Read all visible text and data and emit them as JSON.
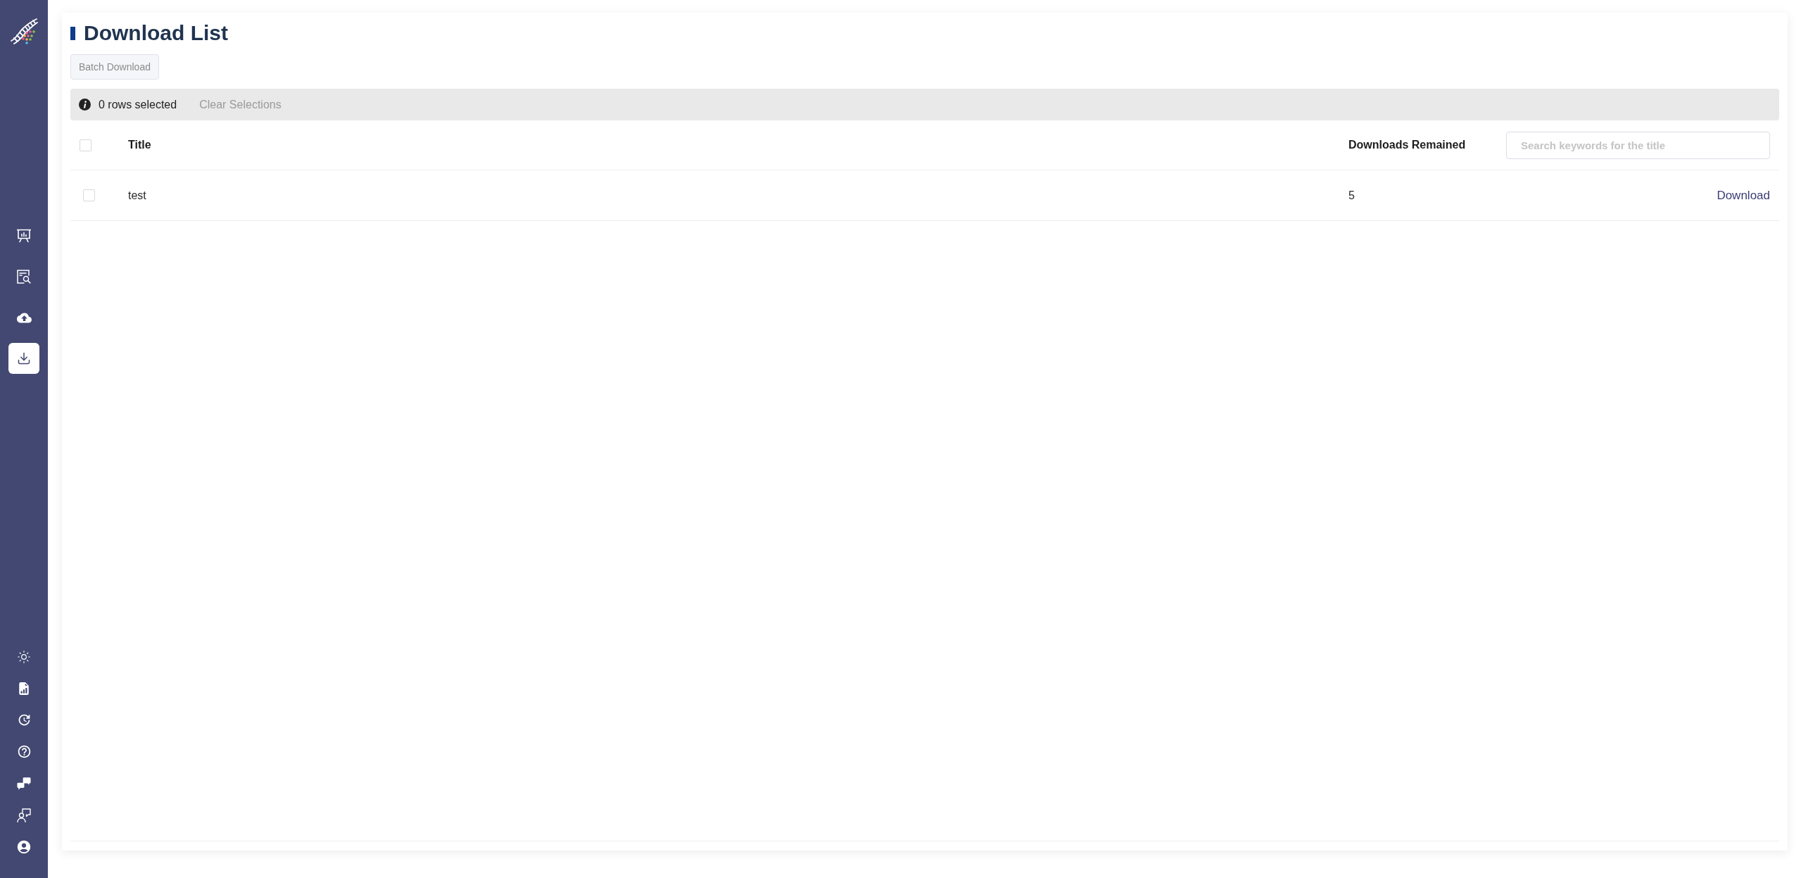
{
  "sidebar": {
    "nav_items": [
      {
        "selected": false
      },
      {
        "selected": false
      },
      {
        "selected": false
      },
      {
        "selected": true
      }
    ],
    "bottom_items": [
      {
        "selected": false
      },
      {
        "selected": false
      },
      {
        "selected": false
      },
      {
        "selected": false
      },
      {
        "selected": false
      },
      {
        "selected": false
      },
      {
        "selected": false
      }
    ]
  },
  "page": {
    "title": "Download List",
    "batch_button": {
      "label": "Batch Download",
      "disabled": true
    }
  },
  "selection_bar": {
    "count_text": "0 rows selected",
    "clear": {
      "label": "Clear Selections",
      "disabled": true
    }
  },
  "table": {
    "select_all": {
      "checked": false
    },
    "columns": [
      "Title",
      "Downloads Remained"
    ],
    "search": {
      "placeholder": "Search keywords for the title"
    },
    "rows": [
      {
        "selected": false,
        "title": "test",
        "downloads_remained": "5",
        "action": "Download"
      }
    ]
  }
}
